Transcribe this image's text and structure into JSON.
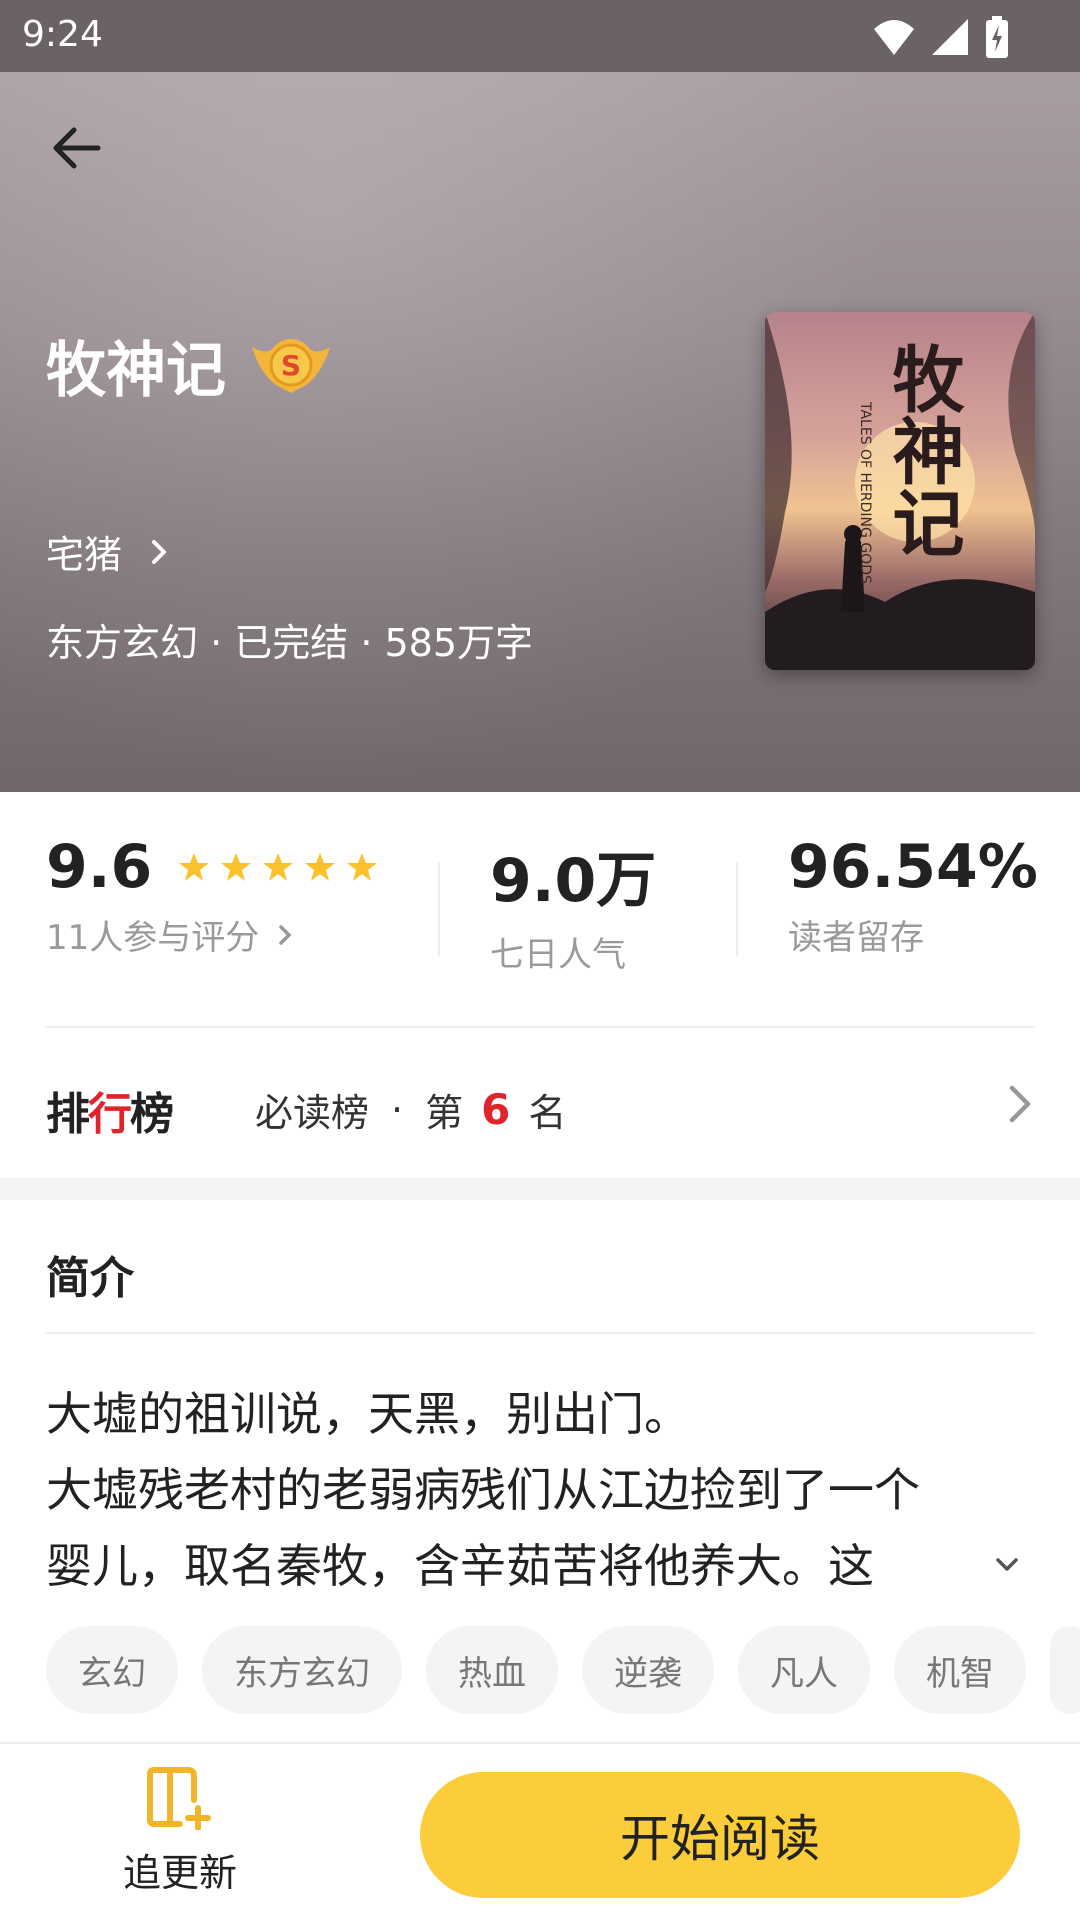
{
  "status_bar": {
    "time": "9:24"
  },
  "book": {
    "title": "牧神记",
    "author": "宅猪",
    "meta": "东方玄幻 · 已完结 · 585万字",
    "cover_title": "牧神记",
    "cover_subtitle": "TALES OF HERDING GODS"
  },
  "stats": {
    "rating": "9.6",
    "rating_stars": 5,
    "rating_sub": "11人参与评分",
    "popularity": "9.0万",
    "popularity_label": "七日人气",
    "retention": "96.54%",
    "retention_label": "读者留存"
  },
  "ranking": {
    "logo_part1": "排",
    "logo_accent": "行",
    "logo_part2": "榜",
    "list_name": "必读榜",
    "dot": "·",
    "prefix": "第",
    "rank": "6",
    "suffix": "名"
  },
  "intro": {
    "heading": "简介",
    "lines": [
      "大墟的祖训说，天黑，别出门。",
      "大墟残老村的老弱病残们从江边捡到了一个",
      "婴儿，取名秦牧，含辛茹苦将他养大。这"
    ]
  },
  "tags": [
    "玄幻",
    "东方玄幻",
    "热血",
    "逆袭",
    "凡人",
    "机智"
  ],
  "bottom": {
    "follow_label": "追更新",
    "read_label": "开始阅读"
  },
  "colors": {
    "accent_yellow": "#fccd3a",
    "rank_red": "#e0242e",
    "star": "#fcc22d"
  }
}
